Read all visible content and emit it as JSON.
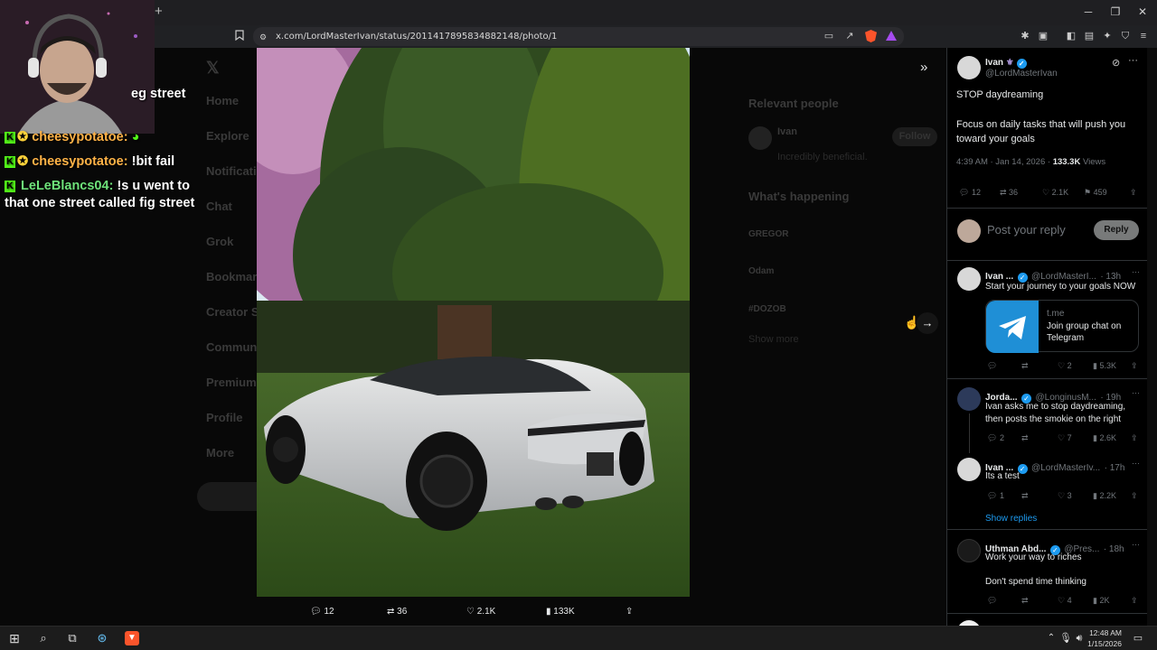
{
  "browser": {
    "url": "x.com/LordMasterIvan/status/2011417895834882148/photo/1",
    "new_tab": "+",
    "win_min": "─",
    "win_max": "❐",
    "win_close": "✕"
  },
  "chat": {
    "partial_line": "eg street",
    "messages": [
      {
        "user": "cheesypotatoe",
        "sep": ":",
        "text": ""
      },
      {
        "user": "cheesypotatoe",
        "sep": ":",
        "text": "!bit fail"
      },
      {
        "user": "LeLeBlancs04",
        "sep": ":",
        "text": "!s u went to"
      },
      {
        "user": "",
        "sep": "",
        "text": "that one street called fig street"
      }
    ]
  },
  "background_page": {
    "nav": [
      "Home",
      "Explore",
      "Notifications",
      "Chat",
      "Grok",
      "Bookmarks",
      "Creator Studio",
      "Communities",
      "Premium",
      "Profile",
      "More"
    ],
    "relevant_heading": "Relevant people",
    "relevant_name": "Ivan",
    "relevant_bio": "Incredibly beneficial.",
    "follow": "Follow",
    "happening_heading": "What's happening",
    "trends": [
      "GREGOR",
      "Odam",
      "#DOZOB"
    ],
    "show_more": "Show more"
  },
  "photo_actions": {
    "replies": "12",
    "reposts": "36",
    "likes": "2.1K",
    "views": "133K"
  },
  "post": {
    "name": "Ivan",
    "handle": "@LordMasterIvan",
    "line1": "STOP daydreaming",
    "line2": "Focus on daily tasks that will push you toward your goals",
    "time": "4:39 AM · Jan 14, 2026 ·",
    "views_count": "133.3K",
    "views_label": "Views",
    "replies": "12",
    "reposts": "36",
    "likes": "2.1K",
    "bookmarks": "459",
    "reply_placeholder": "Post your reply",
    "reply_button": "Reply"
  },
  "replies": [
    {
      "name": "Ivan ...",
      "handle": "@LordMasterI...",
      "time": "· 13h",
      "text": "Start your journey to your goals NOW",
      "card_domain": "t.me",
      "card_title": "Join group chat on Telegram",
      "r": "",
      "rt": "",
      "l": "2",
      "v": "5.3K"
    },
    {
      "name": "Jorda...",
      "handle": "@LonginusM...",
      "time": "· 19h",
      "text": "Ivan asks me to stop daydreaming, then posts the smokie on the right",
      "r": "2",
      "rt": "",
      "l": "7",
      "v": "2.6K"
    },
    {
      "name": "Ivan ...",
      "handle": "@LordMasterIv...",
      "time": "· 17h",
      "text": "Its a test",
      "r": "1",
      "rt": "",
      "l": "3",
      "v": "2.2K"
    },
    {
      "name": "Uthman Abd...",
      "handle": "@Pres...",
      "time": "· 18h",
      "text": "Work your way to riches",
      "text2": "Don't spend time thinking",
      "r": "",
      "rt": "",
      "l": "4",
      "v": "2K"
    }
  ],
  "show_replies": "Show replies",
  "taskbar": {
    "time": "12:48 AM",
    "date": "1/15/2026"
  }
}
